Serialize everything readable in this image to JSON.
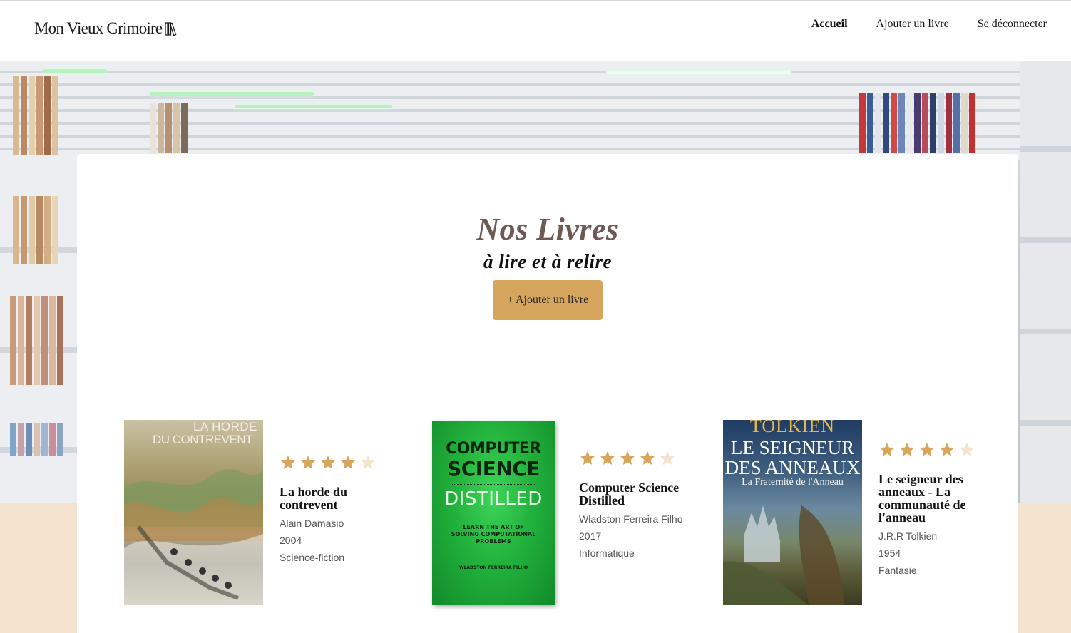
{
  "header": {
    "logo_text": "Mon Vieux Grimoire",
    "nav": [
      {
        "label": "Accueil",
        "active": true
      },
      {
        "label": "Ajouter un livre",
        "active": false
      },
      {
        "label": "Se déconnecter",
        "active": false
      }
    ]
  },
  "main": {
    "title": "Nos Livres",
    "subtitle": "à lire et à relire",
    "add_button_label": "+ Ajouter un livre"
  },
  "books": [
    {
      "title": "La horde du contrevent",
      "author": "Alain Damasio",
      "year": "2004",
      "genre": "Science-fiction",
      "rating": 4,
      "cover": {
        "line1": "LA HORDE",
        "line2": "DU CONTREVENT"
      }
    },
    {
      "title": "Computer Science Distilled",
      "author": "Wladston Ferreira Filho",
      "year": "2017",
      "genre": "Informatique",
      "rating": 4,
      "cover": {
        "line1": "COMPUTER",
        "line2": "SCIENCE",
        "line3": "DISTILLED",
        "tagline": "LEARN THE ART OF SOLVING COMPUTATIONAL PROBLEMS",
        "author": "WLADSTON FERREIRA FILHO"
      }
    },
    {
      "title": "Le seigneur des anneaux - La communauté de l'anneau",
      "author": "J.R.R Tolkien",
      "year": "1954",
      "genre": "Fantasie",
      "rating": 4,
      "cover": {
        "line0": "TOLKIEN",
        "line1": "LE SEIGNEUR",
        "line2": "DES ANNEAUX",
        "line3": "La Fraternité de l'Anneau"
      }
    }
  ],
  "colors": {
    "accent": "#d6a55d",
    "title": "#6e5a53",
    "star_on": "#d9a55a",
    "star_off": "#f3e3cf",
    "footer_bg": "#f3e3cf"
  },
  "icons": {
    "logo": "books-icon",
    "star": "star-icon"
  }
}
